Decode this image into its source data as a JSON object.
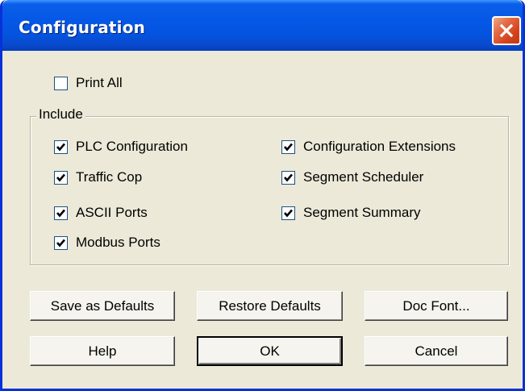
{
  "window": {
    "title": "Configuration"
  },
  "print_all": {
    "label": "Print All",
    "checked": false
  },
  "include_group": {
    "legend": "Include",
    "left_column": [
      {
        "label": "PLC Configuration",
        "checked": true
      },
      {
        "label": "Traffic Cop",
        "checked": true
      },
      {
        "label": "ASCII Ports",
        "checked": true
      },
      {
        "label": "Modbus Ports",
        "checked": true
      }
    ],
    "right_column": [
      {
        "label": "Configuration Extensions",
        "checked": true
      },
      {
        "label": "Segment Scheduler",
        "checked": true
      },
      {
        "label": "Segment Summary",
        "checked": true
      }
    ]
  },
  "buttons": {
    "save_defaults": "Save as Defaults",
    "restore_defaults": "Restore Defaults",
    "doc_font": "Doc Font...",
    "help": "Help",
    "ok": "OK",
    "cancel": "Cancel"
  },
  "icons": {
    "close": "close-icon",
    "check": "check-icon"
  },
  "colors": {
    "titlebar": "#0558e6",
    "close_button": "#d4421b",
    "dialog_face": "#ece9d8"
  }
}
